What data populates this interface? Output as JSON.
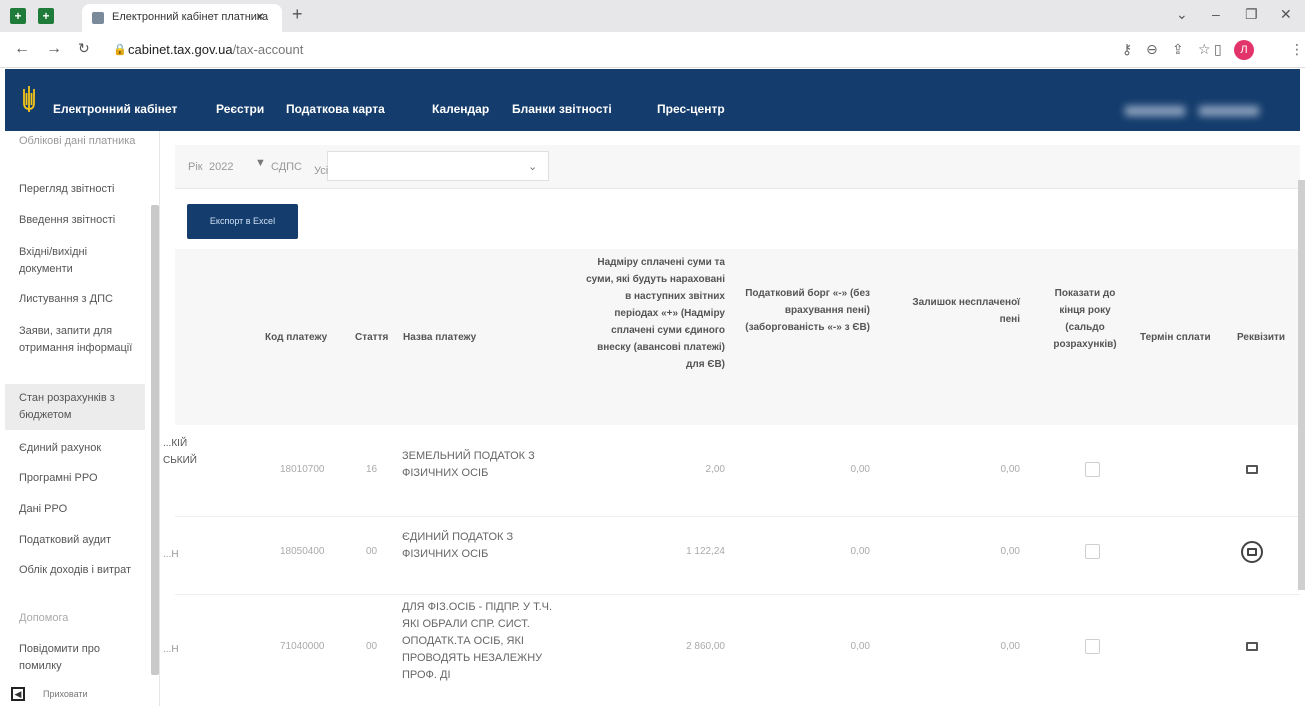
{
  "browser": {
    "tab_title": "Електронний кабінет платника",
    "url_host": "cabinet.tax.gov.ua",
    "url_path": "/tax-account",
    "profile_initial": "Л"
  },
  "header": {
    "brand": "Електронний кабінет",
    "menu": [
      "Реєстри",
      "Податкова карта",
      "Календар",
      "Бланки звітності",
      "Прес-центр"
    ]
  },
  "sidebar": {
    "items": [
      "Облікові дані платника",
      "Перегляд звітності",
      "Введення звітності",
      "Вхідні/вихідні документи",
      "Листування з ДПС",
      "Заяви, запити для отримання інформації",
      "Стан розрахунків з бюджетом",
      "Єдиний рахунок",
      "Програмні РРО",
      "Дані РРО",
      "Податковий аудит",
      "Облік доходів і витрат",
      "Допомога",
      "Повідомити про помилку"
    ],
    "active_index": 6,
    "collapse_label": "Приховати"
  },
  "filters": {
    "year_label": "Рік",
    "year_value": "2022",
    "sdps_label": "СДПС",
    "sdps_value": "Усі"
  },
  "export_button": "Експорт в Excel",
  "table": {
    "columns": {
      "code": "Код платежу",
      "article": "Стаття",
      "name": "Назва платежу",
      "overpaid": "Надміру сплачені суми та суми, які будуть нараховані в наступних звітних періодах «+» (Надміру сплачені суми єдиного внеску (авансові платежі) для ЄВ)",
      "debt": "Податковий борг «-» (без врахування пені) (заборгованість «-» з ЄВ)",
      "penalty": "Залишок несплаченої пені",
      "show_year_end": "Показати до кінця року (сальдо розрахунків)",
      "due": "Термін сплати",
      "details": "Реквізити"
    },
    "rows": [
      {
        "region": "...КІЙ СЬКИЙ",
        "code": "18010700",
        "article": "16",
        "name": "ЗЕМЕЛЬНИЙ ПОДАТОК З ФІЗИЧНИХ ОСІБ",
        "overpaid": "2,00",
        "debt": "0,00",
        "penalty": "0,00"
      },
      {
        "region": "...Н",
        "code": "18050400",
        "article": "00",
        "name": "ЄДИНИЙ ПОДАТОК З ФІЗИЧНИХ ОСІБ",
        "overpaid": "1 122,24",
        "debt": "0,00",
        "penalty": "0,00"
      },
      {
        "region": "...Н",
        "code": "71040000",
        "article": "00",
        "name": "ДЛЯ ФІЗ.ОСІБ - ПІДПР. У Т.Ч. ЯКІ ОБРАЛИ СПР. СИСТ. ОПОДАТК.ТА ОСІБ, ЯКІ ПРОВОДЯТЬ НЕЗАЛЕЖНУ ПРОФ. ДІ",
        "overpaid": "2 860,00",
        "debt": "0,00",
        "penalty": "0,00"
      }
    ]
  }
}
